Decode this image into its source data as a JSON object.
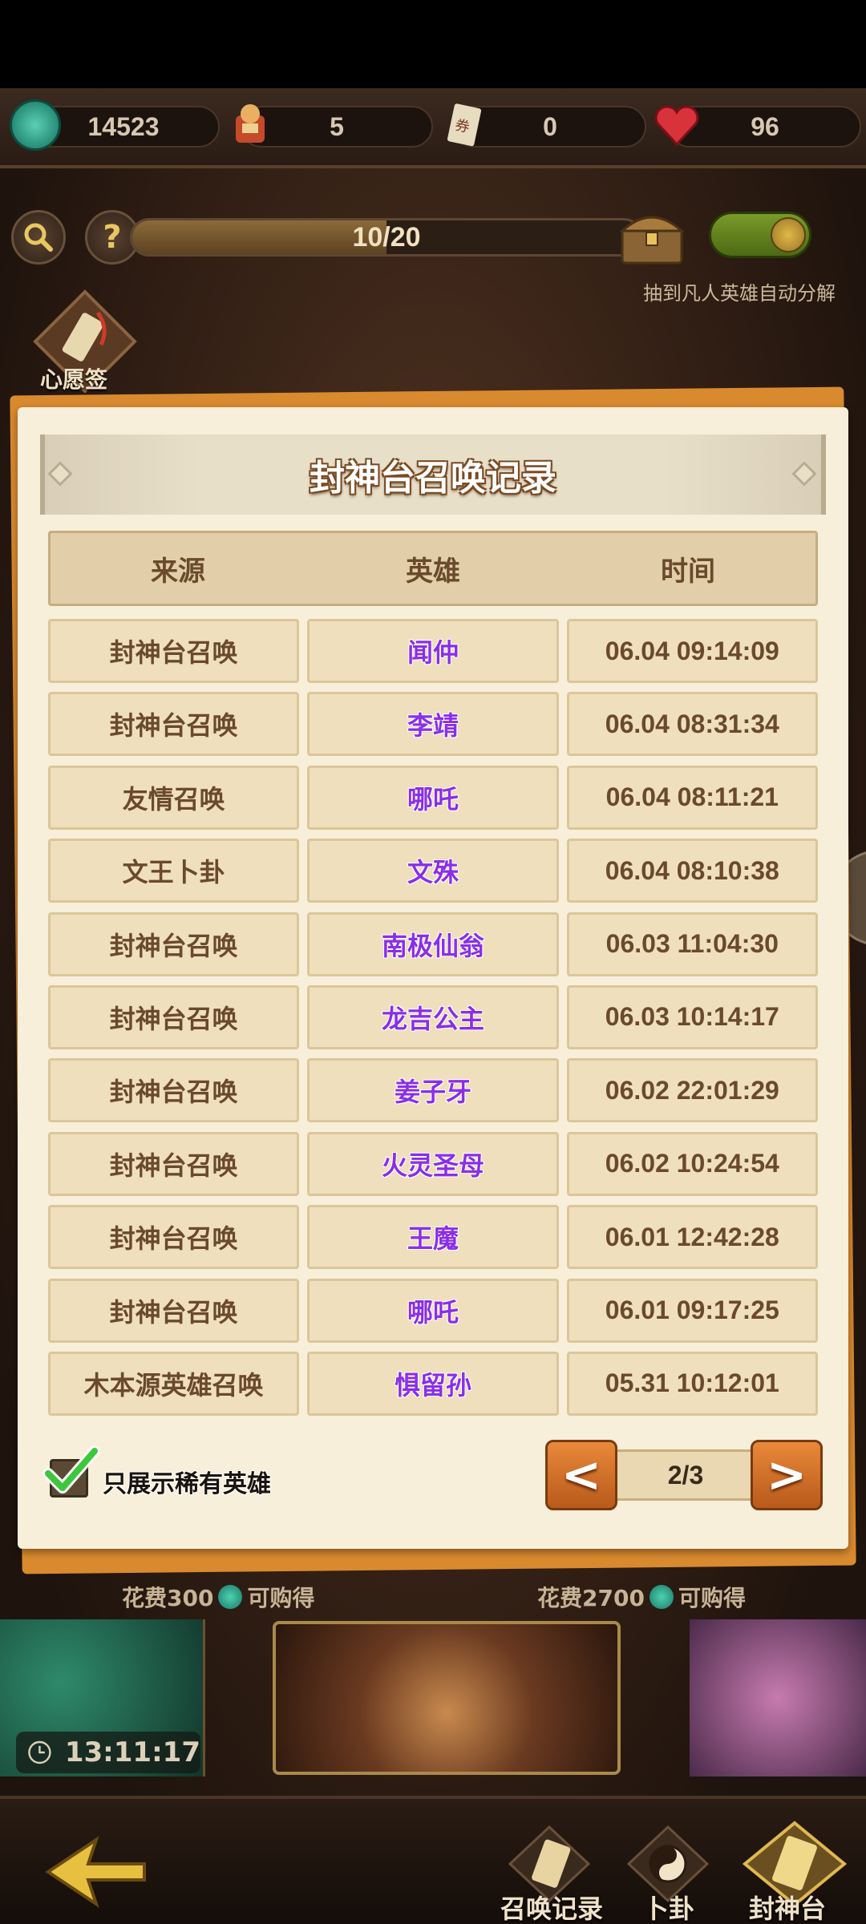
{
  "resources": [
    {
      "icon": "jade-coin-icon",
      "value": "14523"
    },
    {
      "icon": "hero-token-icon",
      "value": "5"
    },
    {
      "icon": "scroll-icon",
      "value": "0"
    },
    {
      "icon": "heart-icon",
      "value": "96"
    }
  ],
  "summon": {
    "progress_text": "10/20",
    "progress_fraction": 0.5,
    "auto_decompose_label": "抽到凡人英雄自动分解",
    "wish_label": "心愿签"
  },
  "dialog": {
    "title": "封神台召唤记录",
    "headers": [
      "来源",
      "英雄",
      "时间"
    ],
    "rows": [
      {
        "source": "封神台召唤",
        "hero": "闻仲",
        "time": "06.04 09:14:09"
      },
      {
        "source": "封神台召唤",
        "hero": "李靖",
        "time": "06.04 08:31:34"
      },
      {
        "source": "友情召唤",
        "hero": "哪吒",
        "time": "06.04 08:11:21"
      },
      {
        "source": "文王卜卦",
        "hero": "文殊",
        "time": "06.04 08:10:38"
      },
      {
        "source": "封神台召唤",
        "hero": "南极仙翁",
        "time": "06.03 11:04:30"
      },
      {
        "source": "封神台召唤",
        "hero": "龙吉公主",
        "time": "06.03 10:14:17"
      },
      {
        "source": "封神台召唤",
        "hero": "姜子牙",
        "time": "06.02 22:01:29"
      },
      {
        "source": "封神台召唤",
        "hero": "火灵圣母",
        "time": "06.02 10:24:54"
      },
      {
        "source": "封神台召唤",
        "hero": "王魔",
        "time": "06.01 12:42:28"
      },
      {
        "source": "封神台召唤",
        "hero": "哪吒",
        "time": "06.01 09:17:25"
      },
      {
        "source": "木本源英雄召唤",
        "hero": "惧留孙",
        "time": "05.31 10:12:01"
      }
    ],
    "filter_label": "只展示稀有英雄",
    "filter_checked": true,
    "prev_label": "<",
    "next_label": ">",
    "page": "2/3"
  },
  "bottom": {
    "cost_left": "花费300",
    "cost_right": "花费2700",
    "can_buy": "可购得",
    "timer": "13:11:17",
    "nav": [
      {
        "label": "召唤记录"
      },
      {
        "label": "卜卦"
      },
      {
        "label": "封神台"
      }
    ]
  },
  "colors": {
    "hero_name": "#8a2ee8",
    "dialog_bg": "#f7efd9",
    "pager_button": "#d9742a"
  }
}
